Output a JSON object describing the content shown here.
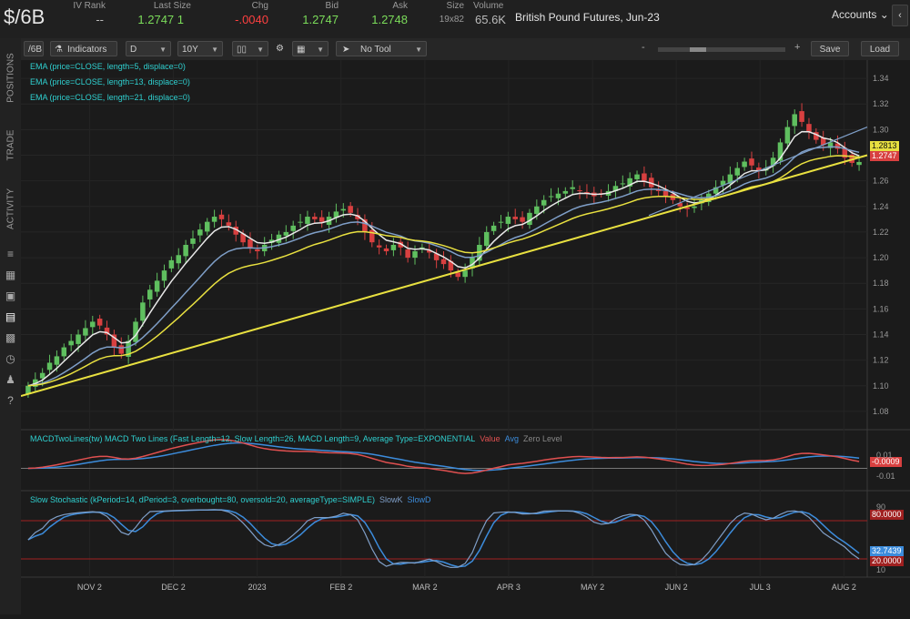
{
  "symbol": "$/6B",
  "quote": {
    "headers": [
      "IV Rank",
      "Last Size",
      "Chg",
      "Bid",
      "Ask",
      "Size",
      "Volume"
    ],
    "iv_rank": "--",
    "last_size": "1.2747 1",
    "chg": "-.0040",
    "bid": "1.2747",
    "ask": "1.2748",
    "size": "19x82",
    "volume": "65.6K",
    "description": "British Pound Futures, Jun-23"
  },
  "accounts": {
    "label": "Accounts",
    "menu_icon": "chevron-down-icon",
    "button_icon": "left-chevron-icon"
  },
  "sidebar": {
    "tabs": [
      "POSITIONS",
      "TRADE",
      "ACTIVITY"
    ],
    "icons": [
      "list-icon",
      "table-icon",
      "clipboard-icon",
      "chart-icon",
      "grid-icon",
      "clock-icon",
      "people-icon",
      "help-icon"
    ]
  },
  "toolbar": {
    "symbol": "/6B",
    "indicators_label": "Indicators",
    "aggregation": "D",
    "timeframe": "10Y",
    "drawing_tool": "No Tool",
    "zoom_minus": "-",
    "zoom_plus": "+",
    "save_label": "Save",
    "load_label": "Load"
  },
  "studies": {
    "ema": [
      "EMA (price=CLOSE, length=5, displace=0)",
      "EMA (price=CLOSE, length=13, displace=0)",
      "EMA (price=CLOSE, length=21, displace=0)"
    ],
    "macd": {
      "label": "MACDTwoLines(tw) MACD Two Lines (Fast Length=12, Slow Length=26, MACD Length=9, Average Type=EXPONENTIAL",
      "legend": [
        "Value",
        "Avg",
        "Zero Level"
      ],
      "scale": [
        "0.01",
        "-0.01"
      ],
      "current": "-0.0009"
    },
    "stoch": {
      "label": "Slow Stochastic (kPeriod=14, dPeriod=3, overbought=80, oversold=20, averageType=SIMPLE)",
      "legend": [
        "SlowK",
        "SlowD"
      ],
      "scale": [
        "90",
        "10"
      ],
      "overbought_tag": "80.0000",
      "oversold_tag": "20.0000",
      "current": "32.7439"
    }
  },
  "price_scale": [
    "1.34",
    "1.32",
    "1.30",
    "1.28",
    "1.26",
    "1.24",
    "1.22",
    "1.20",
    "1.18",
    "1.16",
    "1.14",
    "1.12",
    "1.10",
    "1.08"
  ],
  "price_tags": [
    "1.2813",
    "1.2747"
  ],
  "x_labels": [
    "NOV 2",
    "DEC 2",
    "2023",
    "FEB 2",
    "MAR 2",
    "APR 3",
    "MAY 2",
    "JUN 2",
    "JUL 3",
    "AUG 2"
  ],
  "colors": {
    "up": "#5fbf5f",
    "down": "#d84040",
    "ema5": "#e8e8e8",
    "ema13": "#7f9fc8",
    "ema21": "#e8e040",
    "trendline": "#e8e040",
    "macd_value": "#e05050",
    "macd_avg": "#3c8cdc",
    "study_label": "#2fd0d0"
  },
  "chart_data": {
    "type": "candlestick",
    "y_range": [
      1.07,
      1.35
    ],
    "closes": [
      1.1,
      1.105,
      1.11,
      1.118,
      1.123,
      1.13,
      1.135,
      1.14,
      1.145,
      1.15,
      1.147,
      1.14,
      1.13,
      1.125,
      1.135,
      1.15,
      1.165,
      1.175,
      1.182,
      1.19,
      1.198,
      1.202,
      1.21,
      1.215,
      1.222,
      1.228,
      1.232,
      1.23,
      1.225,
      1.218,
      1.212,
      1.208,
      1.205,
      1.21,
      1.214,
      1.218,
      1.22,
      1.225,
      1.228,
      1.232,
      1.23,
      1.228,
      1.232,
      1.236,
      1.238,
      1.235,
      1.23,
      1.22,
      1.212,
      1.208,
      1.205,
      1.21,
      1.208,
      1.2,
      1.205,
      1.208,
      1.204,
      1.198,
      1.195,
      1.19,
      1.185,
      1.19,
      1.2,
      1.21,
      1.22,
      1.225,
      1.228,
      1.232,
      1.23,
      1.228,
      1.235,
      1.24,
      1.245,
      1.248,
      1.25,
      1.252,
      1.255,
      1.252,
      1.25,
      1.248,
      1.25,
      1.252,
      1.256,
      1.258,
      1.262,
      1.265,
      1.26,
      1.255,
      1.252,
      1.248,
      1.245,
      1.24,
      1.238,
      1.24,
      1.245,
      1.25,
      1.255,
      1.26,
      1.265,
      1.27,
      1.275,
      1.272,
      1.268,
      1.27,
      1.278,
      1.29,
      1.302,
      1.312,
      1.306,
      1.298,
      1.292,
      1.288,
      1.29,
      1.285,
      1.278,
      1.274,
      1.2747
    ]
  }
}
